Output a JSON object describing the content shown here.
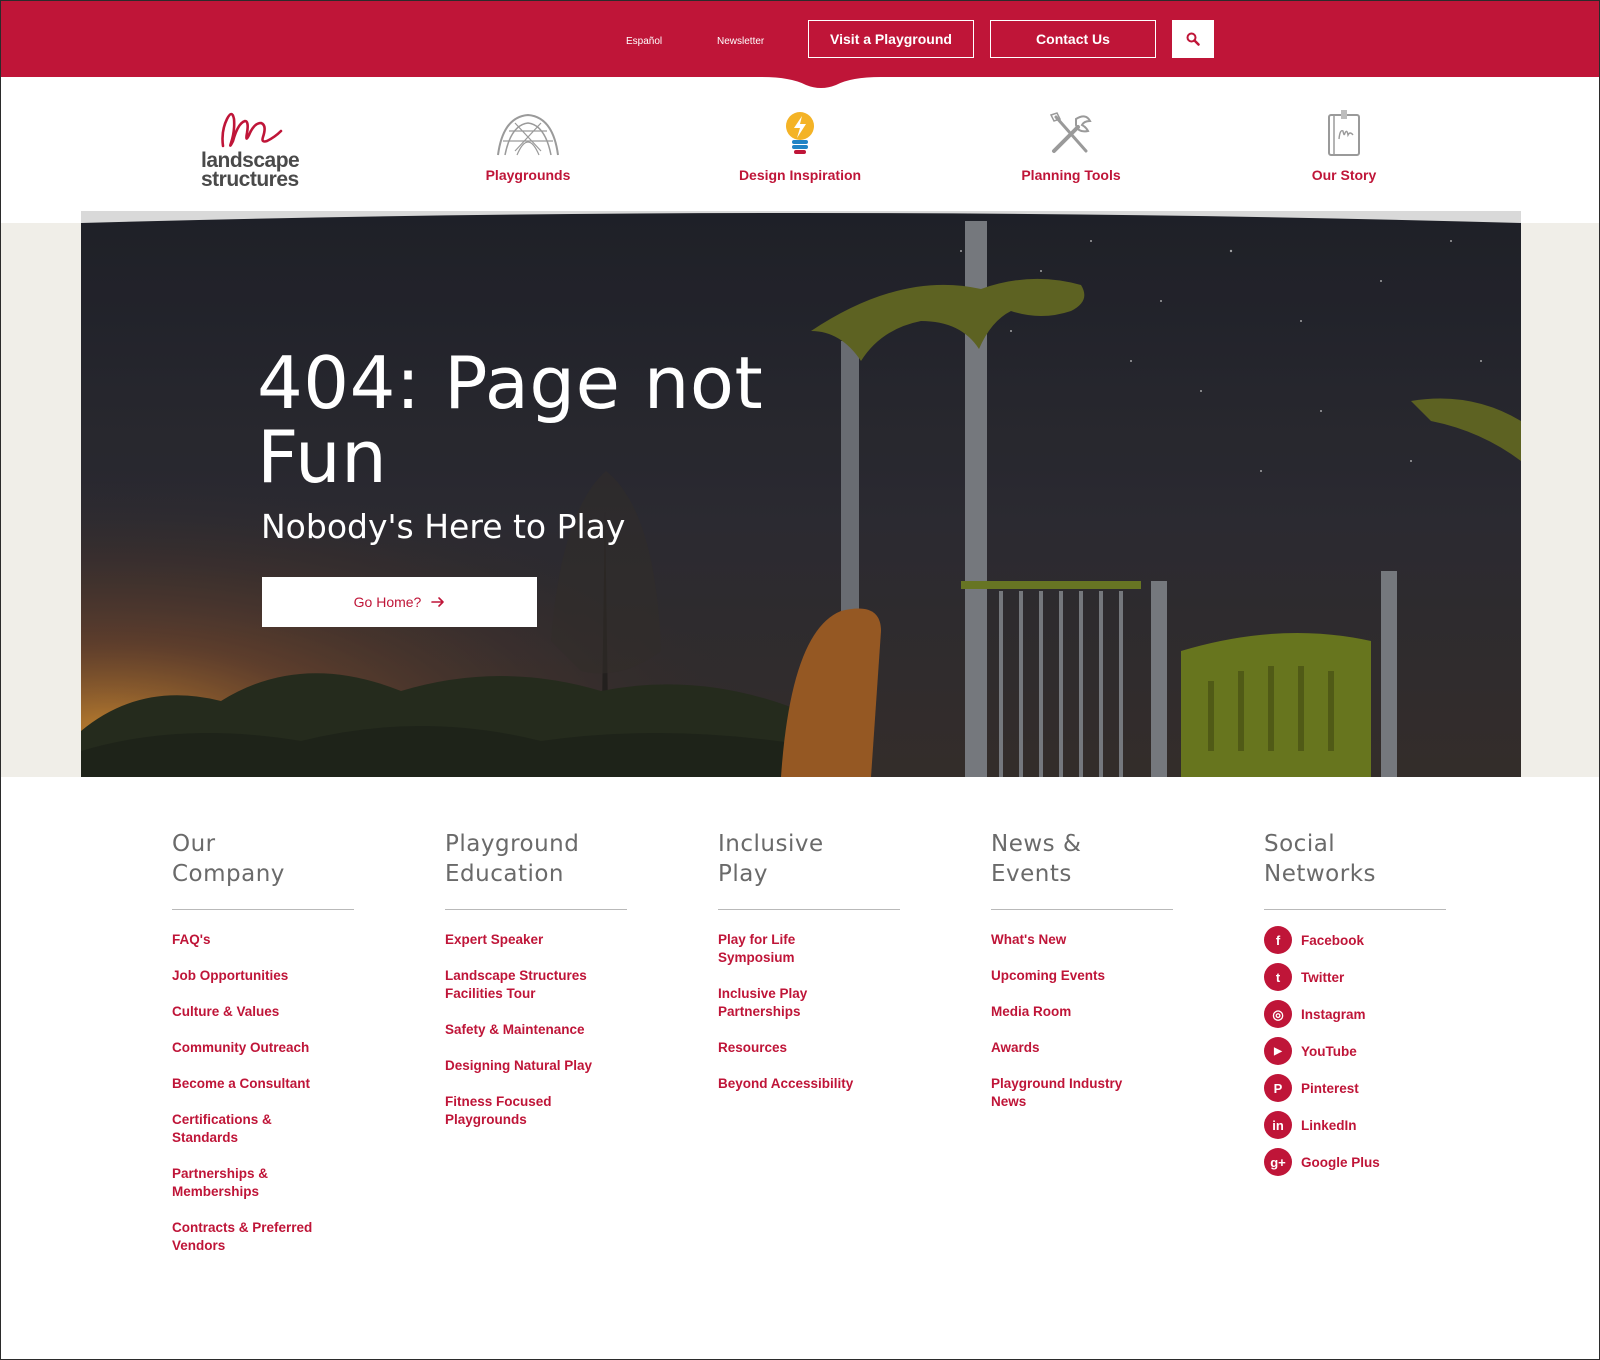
{
  "topbar": {
    "espanol": "Español",
    "newsletter": "Newsletter",
    "visit_button": "Visit a Playground",
    "contact_button": "Contact Us"
  },
  "logo": {
    "line1": "landscape",
    "line2": "structures"
  },
  "nav": [
    {
      "label": "Playgrounds",
      "icon": "playground-dome-icon"
    },
    {
      "label": "Design Inspiration",
      "icon": "lightbulb-icon"
    },
    {
      "label": "Planning Tools",
      "icon": "tools-icon"
    },
    {
      "label": "Our Story",
      "icon": "book-icon"
    }
  ],
  "hero": {
    "title": "404: Page not Fun",
    "subtitle": "Nobody's Here to Play",
    "button_label": "Go Home?"
  },
  "footer": {
    "columns": [
      {
        "heading_line1": "Our",
        "heading_line2": "Company",
        "links": [
          "FAQ's",
          "Job Opportunities",
          "Culture & Values",
          "Community Outreach",
          "Become a Consultant",
          "Certifications & Standards",
          "Partnerships & Memberships",
          "Contracts & Preferred Vendors"
        ]
      },
      {
        "heading_line1": "Playground",
        "heading_line2": "Education",
        "links": [
          "Expert Speaker",
          "Landscape Structures Facilities Tour",
          "Safety & Maintenance",
          "Designing Natural Play",
          "Fitness Focused Playgrounds"
        ]
      },
      {
        "heading_line1": "Inclusive",
        "heading_line2": "Play",
        "links": [
          "Play for Life Symposium",
          "Inclusive Play Partnerships",
          "Resources",
          "Beyond Accessibility"
        ]
      },
      {
        "heading_line1": "News &",
        "heading_line2": "Events",
        "links": [
          "What's New",
          "Upcoming Events",
          "Media Room",
          "Awards",
          "Playground Industry News"
        ]
      }
    ],
    "social": {
      "heading_line1": "Social",
      "heading_line2": "Networks",
      "items": [
        {
          "label": "Facebook",
          "glyph": "f",
          "icon": "facebook-icon"
        },
        {
          "label": "Twitter",
          "glyph": "t",
          "icon": "twitter-icon"
        },
        {
          "label": "Instagram",
          "glyph": "◎",
          "icon": "instagram-icon"
        },
        {
          "label": "YouTube",
          "glyph": "▶",
          "icon": "youtube-icon"
        },
        {
          "label": "Pinterest",
          "glyph": "P",
          "icon": "pinterest-icon"
        },
        {
          "label": "LinkedIn",
          "glyph": "in",
          "icon": "linkedin-icon"
        },
        {
          "label": "Google Plus",
          "glyph": "g+",
          "icon": "google-plus-icon"
        }
      ]
    }
  },
  "colors": {
    "brand_red": "#bf1538",
    "heading_gray": "#6a6a6a",
    "hero_band": "#f0eee8"
  }
}
